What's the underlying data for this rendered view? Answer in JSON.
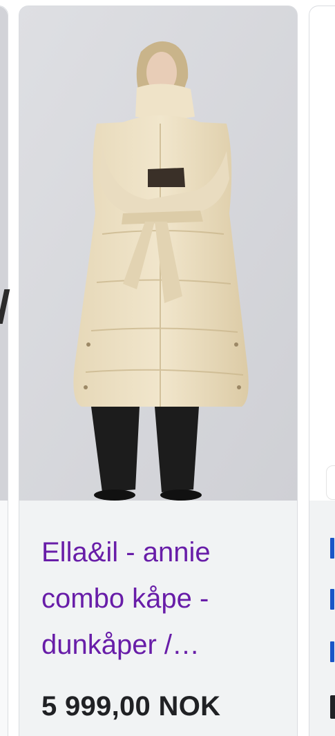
{
  "product_card": {
    "title": "Ella&il - annie combo kåpe - dunkåper /…",
    "price": "5 999,00 NOK"
  },
  "colors": {
    "title_link": "#681da8",
    "price_text": "#202124",
    "card_background": "#f1f3f4",
    "image_background": "#dcdde1"
  }
}
